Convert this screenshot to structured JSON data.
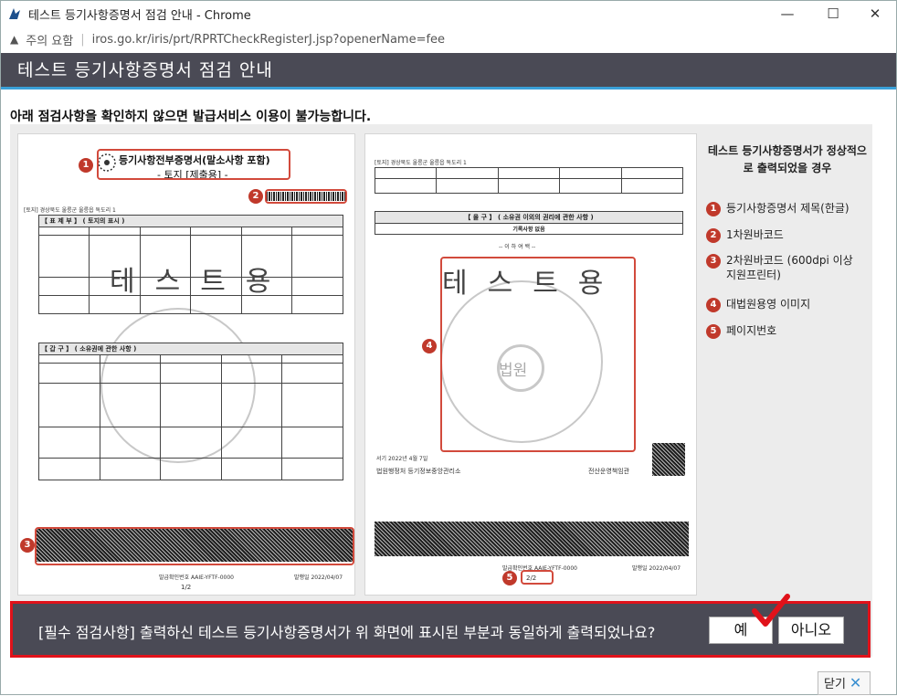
{
  "window": {
    "title": "테스트 등기사항증명서 점검 안내 - Chrome",
    "minimize": "—",
    "maximize": "☐",
    "close": "✕"
  },
  "urlbar": {
    "security_label": "주의 요함",
    "url": "iros.go.kr/iris/prt/RPRTCheckRegisterJ.jsp?openerName=fee"
  },
  "page": {
    "heading": "테스트 등기사항증명서 점검 안내",
    "notice": "아래 점검사항을 확인하지 않으면 발급서비스 이용이 불가능합니다."
  },
  "sample_doc1": {
    "title_line1": "등기사항전부증명서(말소사항 포함)",
    "title_line2": "- 토지 [제출용] -",
    "address": "[토지] 경상북도 울릉군 울릉읍 독도리 1",
    "section1": "【 표 제 부 】 ( 토지의 표시 )",
    "section2": "【 갑 구 】 ( 소유권에 관한 사항 )",
    "watermark": "테스트용",
    "page_no": "1/2",
    "footer_issue_no": "발급확인번호 AAIE-YFTF-0000",
    "footer_date": "발행일 2022/04/07"
  },
  "sample_doc2": {
    "address": "[토지] 경상북도 울릉군 울릉읍 독도리 1",
    "section_eul": "【 을 구 】 ( 소유권 이외의 권리에 관한 사항 )",
    "no_record": "기록사항 없음",
    "end_mark": "-- 이 하 여 백 --",
    "watermark": "테스트용",
    "seal_text": "법원",
    "office": "법원행정처 등기정보중앙관리소",
    "date_line": "서기 2022년 4월 7일",
    "officer": "전산운영책임관",
    "page_no": "2/2",
    "footer_issue_no": "발급확인번호 AAIE-YFTF-0000",
    "footer_date": "발행일 2022/04/07"
  },
  "legend": {
    "title": "테스트 등기사항증명서가 정상적으로 출력되었을 경우",
    "items": [
      {
        "num": "1",
        "label": "등기사항증명서 제목(한글)"
      },
      {
        "num": "2",
        "label": "1차원바코드"
      },
      {
        "num": "3",
        "label": "2차원바코드 (600dpi 이상 지원프린터)"
      },
      {
        "num": "4",
        "label": "대법원용영 이미지"
      },
      {
        "num": "5",
        "label": "페이지번호"
      }
    ]
  },
  "confirm": {
    "question": "[필수 점검사항] 출력하신 테스트 등기사항증명서가 위 화면에 표시된 부분과 동일하게 출력되었나요?",
    "yes_label": "예",
    "no_label": "아니오"
  },
  "footer": {
    "close_label": "닫기"
  },
  "colors": {
    "header_bg": "#4a4a55",
    "accent_blue": "#3aa0d8",
    "marker_red": "#d24a3c",
    "confirm_border": "#e0121a"
  }
}
